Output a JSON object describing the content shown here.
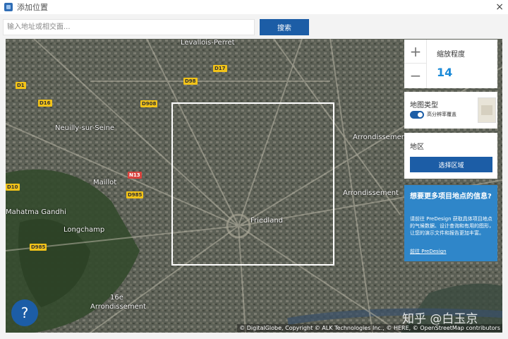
{
  "window": {
    "title": "添加位置",
    "close_glyph": "×"
  },
  "search": {
    "placeholder": "输入地址或相交面...",
    "button_label": "搜索"
  },
  "map": {
    "labels": [
      {
        "name": "map-label-levallois",
        "text": "Levallois-Perret"
      },
      {
        "name": "map-label-neuilly",
        "text": "Neuilly-sur-Seine"
      },
      {
        "name": "map-label-arrondissement-17",
        "text": "Arrondissement"
      },
      {
        "name": "map-label-arrondissement-8",
        "text": "Arrondissement"
      },
      {
        "name": "map-label-arrondissement-16",
        "text": "Arrondissement"
      },
      {
        "name": "map-label-16e",
        "text": "16e"
      },
      {
        "name": "map-label-maillot",
        "text": "Maillot"
      },
      {
        "name": "map-label-longchamp",
        "text": "Longchamp"
      },
      {
        "name": "map-label-gandhi",
        "text": "Mahatma Gandhi"
      },
      {
        "name": "map-label-friedland",
        "text": "Friedland"
      }
    ],
    "road_tags": [
      {
        "name": "road-tag-d17",
        "text": "D17",
        "red": false
      },
      {
        "name": "road-tag-d1",
        "text": "D1",
        "red": false
      },
      {
        "name": "road-tag-d16",
        "text": "D16",
        "red": false
      },
      {
        "name": "road-tag-d908",
        "text": "D908",
        "red": false
      },
      {
        "name": "road-tag-d985",
        "text": "D985",
        "red": false
      },
      {
        "name": "road-tag-d985b",
        "text": "D985",
        "red": false
      },
      {
        "name": "road-tag-n13",
        "text": "N13",
        "red": true
      },
      {
        "name": "road-tag-d10",
        "text": "D10",
        "red": false
      },
      {
        "name": "road-tag-d98",
        "text": "D98",
        "red": false
      }
    ]
  },
  "zoom": {
    "plus_glyph": "+",
    "minus_glyph": "−",
    "label": "缩放程度",
    "value": "14"
  },
  "map_type": {
    "label": "地图类型",
    "toggle_label": "高分辨率覆盖"
  },
  "region": {
    "label": "地区",
    "button_label": "选择区域"
  },
  "promo": {
    "title": "想要更多项目地点的信息?",
    "body": "请前往 PreDesign 获取具体项目地点的气候数据、设计查询和有用的图形，让您的演示文件和报告更加丰富。",
    "link": "前往 PreDesign"
  },
  "help": {
    "glyph": "?"
  },
  "watermark": "知乎 @白玉京",
  "copyright": "© DigitalGlobe, Copyright © ALK Technologies Inc., © HERE, © OpenStreetMap contributors",
  "colors": {
    "accent": "#1c5da6",
    "promo": "#2f86c9",
    "zoom_value": "#1b8ad8"
  }
}
